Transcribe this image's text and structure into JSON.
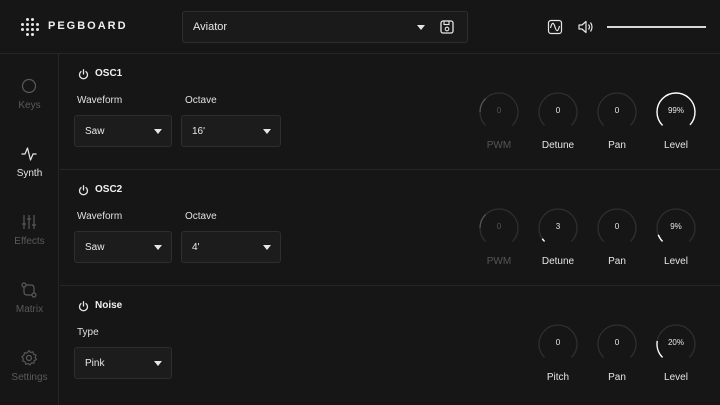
{
  "app": {
    "brand": "PEGBOARD"
  },
  "header": {
    "preset_name": "Aviator"
  },
  "sidebar": {
    "items": [
      {
        "label": "Keys",
        "icon": "circle-icon",
        "active": false
      },
      {
        "label": "Synth",
        "icon": "waveform-icon",
        "active": true
      },
      {
        "label": "Effects",
        "icon": "sliders-icon",
        "active": false
      },
      {
        "label": "Matrix",
        "icon": "routing-icon",
        "active": false
      },
      {
        "label": "Settings",
        "icon": "gear-icon",
        "active": false
      }
    ]
  },
  "osc1": {
    "title": "OSC1",
    "waveform_label": "Waveform",
    "waveform_value": "Saw",
    "octave_label": "Octave",
    "octave_value": "16'",
    "knobs": [
      {
        "label": "PWM",
        "value": "0",
        "level": 0,
        "disabled": true
      },
      {
        "label": "Detune",
        "value": "0",
        "level": 0,
        "disabled": false
      },
      {
        "label": "Pan",
        "value": "0",
        "level": 0,
        "disabled": false
      },
      {
        "label": "Level",
        "value": "99%",
        "level": 0.99,
        "disabled": false
      }
    ]
  },
  "osc2": {
    "title": "OSC2",
    "waveform_label": "Waveform",
    "waveform_value": "Saw",
    "octave_label": "Octave",
    "octave_value": "4'",
    "knobs": [
      {
        "label": "PWM",
        "value": "0",
        "level": 0,
        "disabled": true
      },
      {
        "label": "Detune",
        "value": "3",
        "level": 0.03,
        "disabled": false
      },
      {
        "label": "Pan",
        "value": "0",
        "level": 0,
        "disabled": false
      },
      {
        "label": "Level",
        "value": "9%",
        "level": 0.09,
        "disabled": false
      }
    ]
  },
  "noise": {
    "title": "Noise",
    "type_label": "Type",
    "type_value": "Pink",
    "knobs": [
      {
        "label": "Pitch",
        "value": "0",
        "level": 0,
        "disabled": false
      },
      {
        "label": "Pan",
        "value": "0",
        "level": 0,
        "disabled": false
      },
      {
        "label": "Level",
        "value": "20%",
        "level": 0.2,
        "disabled": false
      }
    ]
  },
  "colors": {
    "background": "#161616",
    "arc": "#ffffff",
    "track": "#2f2f2f",
    "disabled": "#555555"
  }
}
